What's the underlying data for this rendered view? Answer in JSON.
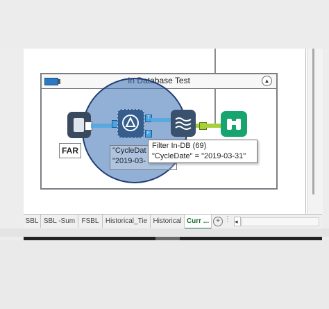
{
  "container": {
    "title": "In Database Test",
    "collapse_glyph": "▲"
  },
  "tools": {
    "far_label": "FAR",
    "filter_label_line1": "\"CycleDat",
    "filter_label_line2": "\"2019-03-",
    "anchor_t": "T",
    "anchor_f": "F"
  },
  "tooltip": {
    "line1": "Filter In-DB (69)",
    "line2": "\"CycleDate\" = \"2019-03-31\""
  },
  "tabs": [
    {
      "label": "SBL"
    },
    {
      "label": "SBL -Sum"
    },
    {
      "label": "FSBL"
    },
    {
      "label": "Historical_Tie"
    },
    {
      "label": "Historical"
    },
    {
      "label": "Curr ..."
    }
  ],
  "tab_controls": {
    "add_glyph": "+",
    "more_glyph": "⋮",
    "prev_glyph": "◂"
  },
  "icons": {
    "far": "input-data-icon",
    "filter": "filter-in-db-icon",
    "stream": "data-stream-out-icon",
    "browse": "browse-binoculars-icon",
    "container": "container-icon"
  },
  "colors": {
    "spotlight": "#3a6fb2",
    "browse_tool": "#16a56f",
    "active_tab": "#217346"
  }
}
